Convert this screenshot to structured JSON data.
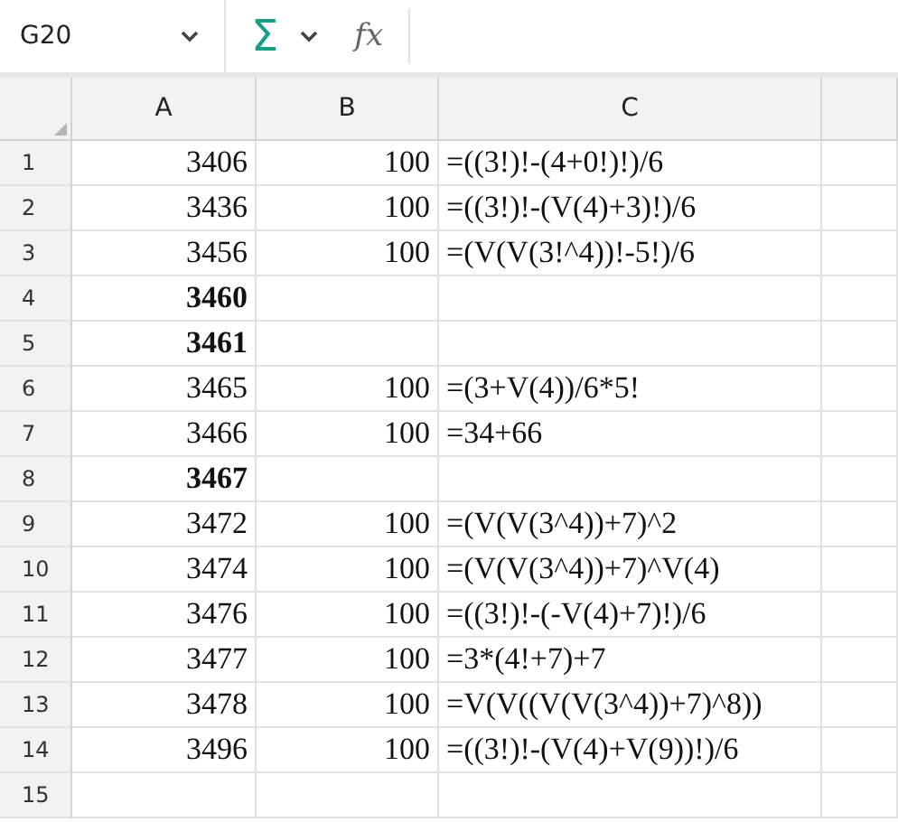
{
  "formula_bar": {
    "name_box": "G20",
    "sum_symbol": "Σ",
    "function_symbol": "fx"
  },
  "columns": [
    "A",
    "B",
    "C"
  ],
  "rows": [
    {
      "number": "1",
      "a": "3406",
      "b": "100",
      "c": "=((3!)!-(4+0!)!)/6",
      "bold": false
    },
    {
      "number": "2",
      "a": "3436",
      "b": "100",
      "c": "=((3!)!-(V(4)+3)!)/6",
      "bold": false
    },
    {
      "number": "3",
      "a": "3456",
      "b": "100",
      "c": "=(V(V(3!^4))!-5!)/6",
      "bold": false
    },
    {
      "number": "4",
      "a": "3460",
      "bold": true
    },
    {
      "number": "5",
      "a": "3461",
      "bold": true
    },
    {
      "number": "6",
      "a": "3465",
      "b": "100",
      "c": "=(3+V(4))/6*5!",
      "bold": false
    },
    {
      "number": "7",
      "a": "3466",
      "b": "100",
      "c": "=34+66",
      "bold": false
    },
    {
      "number": "8",
      "a": "3467",
      "bold": true
    },
    {
      "number": "9",
      "a": "3472",
      "b": "100",
      "c": "=(V(V(3^4))+7)^2",
      "bold": false
    },
    {
      "number": "10",
      "a": "3474",
      "b": "100",
      "c": "=(V(V(3^4))+7)^V(4)",
      "bold": false
    },
    {
      "number": "11",
      "a": "3476",
      "b": "100",
      "c": "=((3!)!-(-V(4)+7)!)/6",
      "bold": false
    },
    {
      "number": "12",
      "a": "3477",
      "b": "100",
      "c": "=3*(4!+7)+7",
      "bold": false
    },
    {
      "number": "13",
      "a": "3478",
      "b": "100",
      "c": "=V(V((V(V(3^4))+7)^8))",
      "bold": false
    },
    {
      "number": "14",
      "a": "3496",
      "b": "100",
      "c": "=((3!)!-(V(4)+V(9))!)/6",
      "bold": false
    },
    {
      "number": "15"
    }
  ]
}
